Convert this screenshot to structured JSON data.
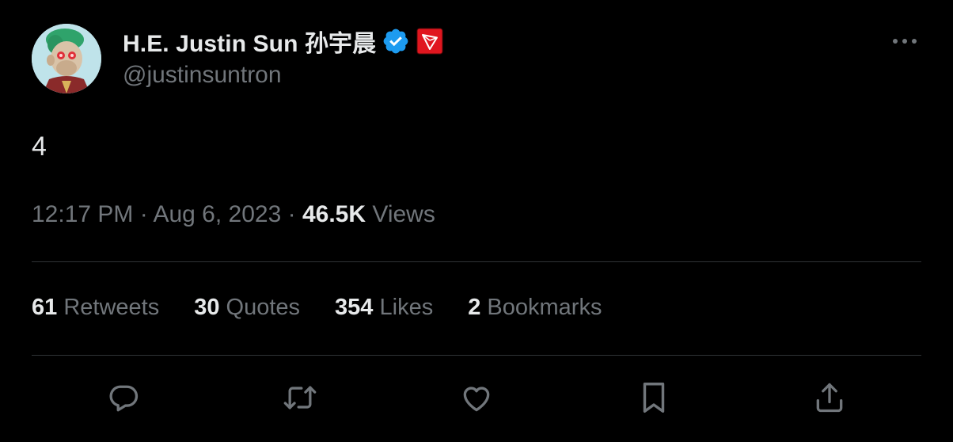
{
  "author": {
    "display_name": "H.E. Justin Sun 孙宇晨",
    "handle": "@justinsuntron",
    "avatar_icon": "ape-avatar",
    "verified_color": "#1d9bf0",
    "affiliate_badge_color": "#e0161f"
  },
  "tweet": {
    "text": "4",
    "time": "12:17 PM",
    "separator": "·",
    "date": "Aug 6, 2023",
    "views_count": "46.5K",
    "views_label": "Views"
  },
  "stats": [
    {
      "count": "61",
      "label": "Retweets"
    },
    {
      "count": "30",
      "label": "Quotes"
    },
    {
      "count": "354",
      "label": "Likes"
    },
    {
      "count": "2",
      "label": "Bookmarks"
    }
  ],
  "actions": [
    "reply-icon",
    "retweet-icon",
    "like-icon",
    "bookmark-icon",
    "share-icon"
  ],
  "colors": {
    "background": "#000000",
    "primary_text": "#e7e9ea",
    "secondary_text": "#71767b",
    "divider": "#2f3336"
  }
}
